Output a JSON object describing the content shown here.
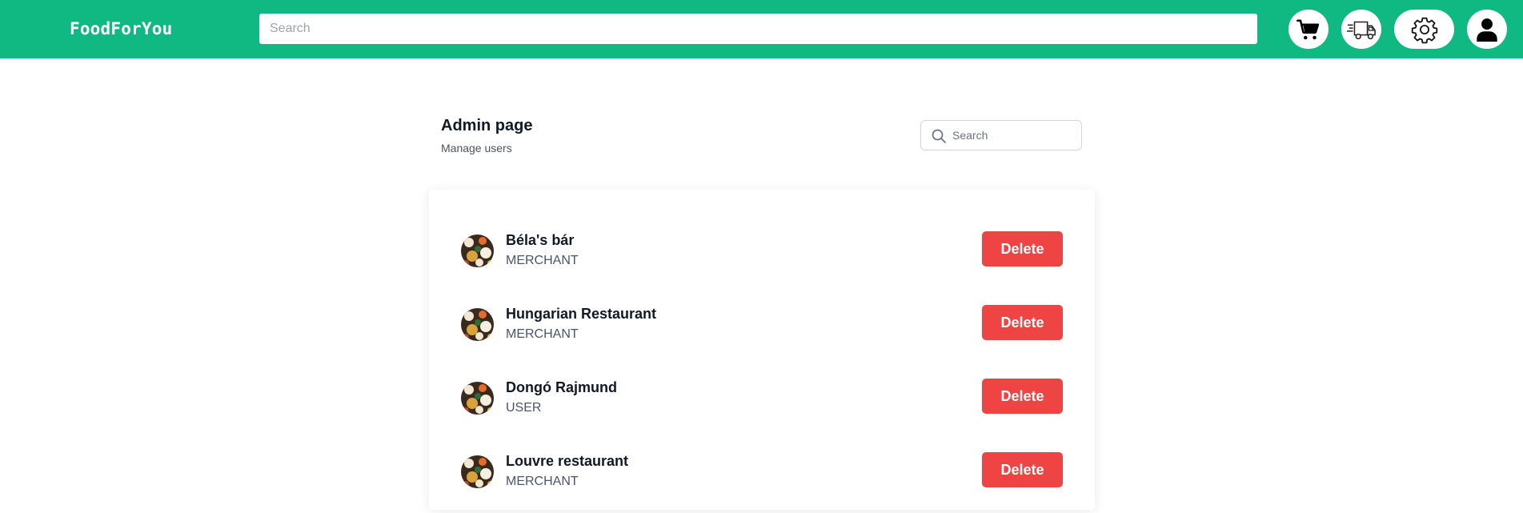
{
  "header": {
    "brand": "FoodForYou",
    "search_placeholder": "Search",
    "icons": [
      "cart-icon",
      "truck-icon",
      "gear-icon",
      "user-icon"
    ]
  },
  "page": {
    "title": "Admin page",
    "subtitle": "Manage users",
    "search_placeholder": "Search"
  },
  "users": [
    {
      "name": "Béla's bár",
      "role": "MERCHANT",
      "delete_label": "Delete"
    },
    {
      "name": "Hungarian Restaurant",
      "role": "MERCHANT",
      "delete_label": "Delete"
    },
    {
      "name": "Dongó Rajmund",
      "role": "USER",
      "delete_label": "Delete"
    },
    {
      "name": "Louvre restaurant",
      "role": "MERCHANT",
      "delete_label": "Delete"
    }
  ],
  "colors": {
    "brand_green": "#10b981",
    "delete_red": "#ef4444",
    "text_dark": "#111827",
    "text_muted": "#4b5563"
  }
}
